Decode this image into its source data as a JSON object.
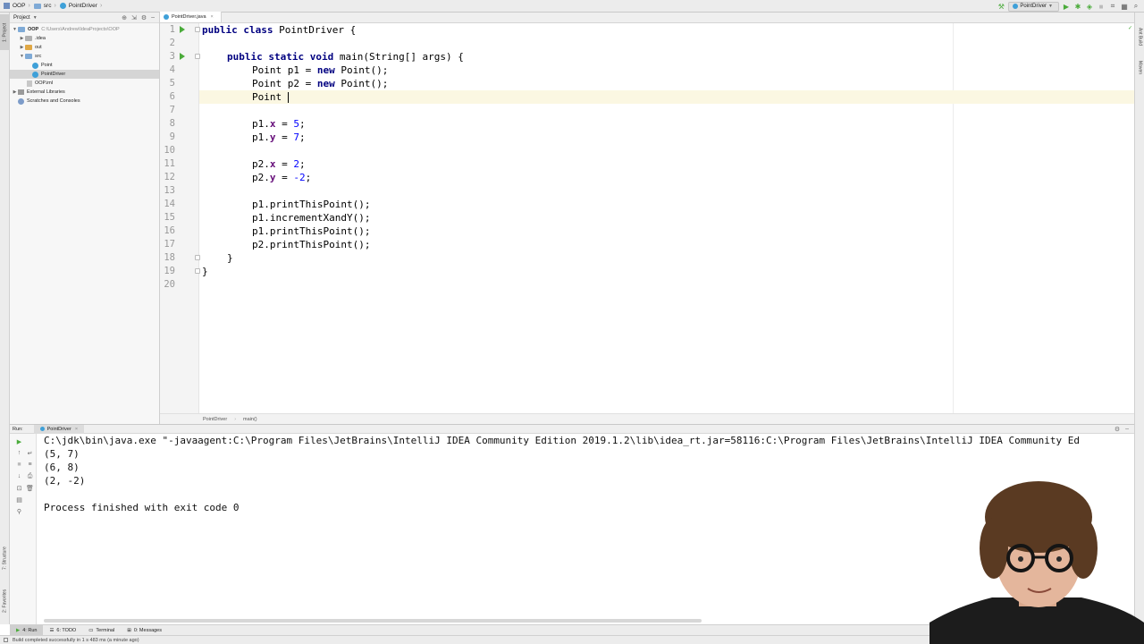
{
  "nav": {
    "project": "OOP",
    "folder": "src",
    "file": "PointDriver"
  },
  "run_config": {
    "label": "PointDriver"
  },
  "left_tabs": {
    "project": "1: Project",
    "structure": "7: Structure",
    "favorites": "2: Favorites"
  },
  "right_tabs": {
    "ant": "Ant Build",
    "maven": "Maven"
  },
  "project_panel": {
    "title": "Project",
    "tree": [
      {
        "label": "OOP",
        "path": "C:\\Users\\Andrew\\IdeaProjects\\OOP"
      },
      {
        "label": ".idea"
      },
      {
        "label": "out"
      },
      {
        "label": "src"
      },
      {
        "label": "Point"
      },
      {
        "label": "PointDriver"
      },
      {
        "label": "OOP.iml"
      },
      {
        "label": "External Libraries"
      },
      {
        "label": "Scratches and Consoles"
      }
    ]
  },
  "editor": {
    "tab": "PointDriver.java",
    "line_numbers": [
      "1",
      "2",
      "3",
      "4",
      "5",
      "6",
      "7",
      "8",
      "9",
      "10",
      "11",
      "12",
      "13",
      "14",
      "15",
      "16",
      "17",
      "18",
      "19",
      "20"
    ],
    "code": {
      "l1_kw": "public class ",
      "l1_rest": "PointDriver {",
      "l3_kw": "public static void ",
      "l3_rest": "main(String[] args) {",
      "l4_a": "Point p1 = ",
      "l4_kw": "new ",
      "l4_b": "Point();",
      "l5_a": "Point p2 = ",
      "l5_kw": "new ",
      "l5_b": "Point();",
      "l6": "Point ",
      "l8_a": "p1.",
      "l8_f": "x",
      "l8_b": " = ",
      "l8_n": "5",
      "l8_c": ";",
      "l9_a": "p1.",
      "l9_f": "y",
      "l9_b": " = ",
      "l9_n": "7",
      "l9_c": ";",
      "l11_a": "p2.",
      "l11_f": "x",
      "l11_b": " = ",
      "l11_n": "2",
      "l11_c": ";",
      "l12_a": "p2.",
      "l12_f": "y",
      "l12_b": " = ",
      "l12_n": "-2",
      "l12_c": ";",
      "l14": "p1.printThisPoint();",
      "l15": "p1.incrementXandY();",
      "l16": "p1.printThisPoint();",
      "l17": "p2.printThisPoint();",
      "l18": "}",
      "l19": "}"
    },
    "breadcrumb": [
      "PointDriver",
      "main()"
    ]
  },
  "run_panel": {
    "label": "Run:",
    "tab": "PointDriver",
    "output": [
      "C:\\jdk\\bin\\java.exe \"-javaagent:C:\\Program Files\\JetBrains\\IntelliJ IDEA Community Edition 2019.1.2\\lib\\idea_rt.jar=58116:C:\\Program Files\\JetBrains\\IntelliJ IDEA Community Ed",
      "(5, 7)",
      "(6, 8)",
      "(2, -2)",
      "",
      "Process finished with exit code 0"
    ]
  },
  "bottom_tabs": {
    "run": "4: Run",
    "todo": "6: TODO",
    "terminal": "Terminal",
    "messages": "0: Messages"
  },
  "status": "Build completed successfully in 1 s 483 ms (a minute ago)",
  "colors": {
    "keyword": "#000080",
    "field": "#660e7a",
    "number": "#0000ff",
    "run_green": "#4aab3a",
    "current_line": "#fbf7e2"
  }
}
